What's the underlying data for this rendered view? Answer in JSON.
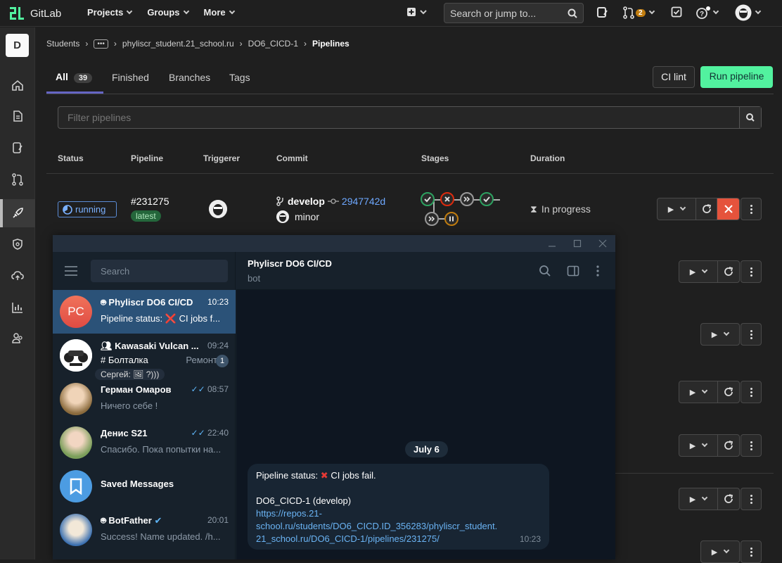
{
  "app": {
    "name": "GitLab"
  },
  "topnav": {
    "projects": "Projects",
    "groups": "Groups",
    "more": "More"
  },
  "search": {
    "placeholder": "Search or jump to..."
  },
  "mr_count": "2",
  "sidebar": {
    "project_initial": "D"
  },
  "breadcrumb": {
    "b1": "Students",
    "b2": "phyliscr_student.21_school.ru",
    "b3": "DO6_CICD-1",
    "b4": "Pipelines"
  },
  "tabs": {
    "all": "All",
    "all_count": "39",
    "finished": "Finished",
    "branches": "Branches",
    "tags": "Tags"
  },
  "buttons": {
    "ci_lint": "CI lint",
    "run_pipeline": "Run pipeline"
  },
  "filter": {
    "placeholder": "Filter pipelines"
  },
  "table": {
    "headers": {
      "status": "Status",
      "pipeline": "Pipeline",
      "triggerer": "Triggerer",
      "commit": "Commit",
      "stages": "Stages",
      "duration": "Duration"
    },
    "row1": {
      "status": "running",
      "id": "#231275",
      "tag": "latest",
      "branch": "develop",
      "sha": "2947742d",
      "message": "minor",
      "duration": "In progress"
    }
  },
  "telegram": {
    "search_placeholder": "Search",
    "chats": [
      {
        "name": "Phyliscr DO6 CI/CD",
        "time": "10:23",
        "preview": "Pipeline status: ❌ CI jobs f...",
        "initials": "PC"
      },
      {
        "name": "Kawasaki Vulcan ...",
        "time": "09:24",
        "preview": "# Болталка",
        "preview2": "Ремонт",
        "preview3": "Сергей: 🖼 ?)))",
        "unread": "1"
      },
      {
        "name": "Герман Омаров",
        "time": "08:57",
        "preview": "Ничего себе !"
      },
      {
        "name": "Денис S21",
        "time": "22:40",
        "preview": "Спасибо. Пока попытки на..."
      },
      {
        "name": "Saved Messages",
        "time": "",
        "preview": ""
      },
      {
        "name": "BotFather",
        "time": "20:01",
        "preview": "Success! Name updated. /h..."
      }
    ],
    "header": {
      "title": "Phyliscr DO6 CI/CD",
      "subtitle": "bot"
    },
    "date": "July 6",
    "message": {
      "line1_prefix": "Pipeline status:",
      "line1_suffix": "CI jobs fail.",
      "line2": "DO6_CICD-1 (develop)",
      "link_l1": "https://repos.21-",
      "link_l2": "school.ru/students/DO6_CICD.ID_356283/phyliscr_student.",
      "link_l3": "21_school.ru/DO6_CICD-1/pipelines/231275/",
      "time": "10:23"
    }
  },
  "colors": {
    "run_button": "#52f29f",
    "cancel": "#e5533c",
    "telegram_selected": "#2b5278"
  }
}
